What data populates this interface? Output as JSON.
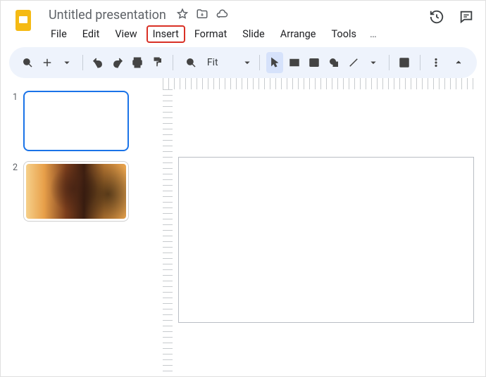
{
  "doc": {
    "title": "Untitled presentation"
  },
  "menus": {
    "file": "File",
    "edit": "Edit",
    "view": "View",
    "insert": "Insert",
    "format": "Format",
    "slide": "Slide",
    "arrange": "Arrange",
    "tools": "Tools"
  },
  "toolbar": {
    "zoom_label": "Fit"
  },
  "slides": {
    "items": [
      {
        "n": "1"
      },
      {
        "n": "2"
      }
    ]
  }
}
